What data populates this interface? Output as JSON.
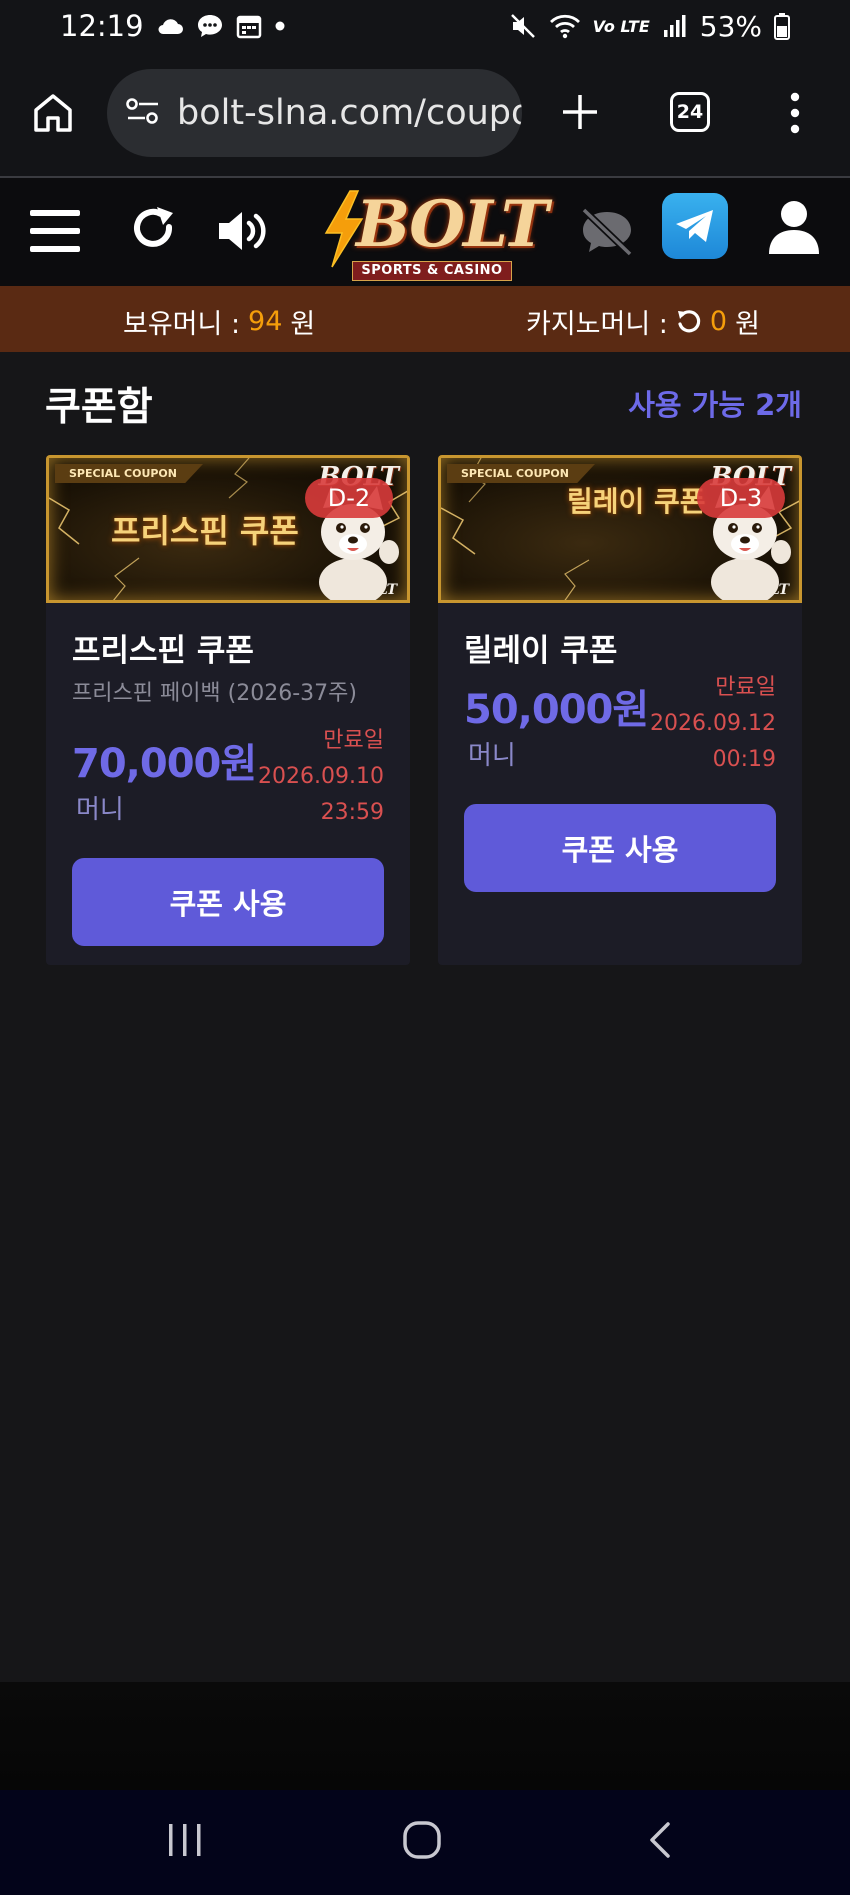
{
  "status_bar": {
    "time": "12:19",
    "battery": "53%",
    "left_icons": [
      "cloud-icon",
      "chat-icon",
      "calendar-icon",
      "dot-icon"
    ],
    "right_icons": [
      "mute-icon",
      "wifi-icon",
      "volte-icon",
      "signal-icon",
      "battery-icon"
    ],
    "lte_label": "Vo LTE"
  },
  "browser": {
    "url": "bolt-slna.com/coupo",
    "tab_count": "24"
  },
  "header": {
    "logo_text": "BOLT",
    "logo_subtitle": "SPORTS & CASINO"
  },
  "balance": {
    "holding_label": "보유머니 :",
    "holding_value": "94",
    "holding_unit": "원",
    "casino_label": "카지노머니 :",
    "casino_value": "0",
    "casino_unit": "원"
  },
  "coupon_box": {
    "title": "쿠폰함",
    "available": "사용 가능 2개"
  },
  "coupons": [
    {
      "banner_tag": "SPECIAL COUPON",
      "banner_title": "프리스핀 쿠폰",
      "banner_logo": "BOLT",
      "dday": "D-2",
      "name": "프리스핀 쿠폰",
      "subtitle": "프리스핀 페이백 (2026-37주)",
      "amount": "70,000원",
      "type": "머니",
      "expire_label": "만료일",
      "expire_date": "2026.09.10",
      "expire_time": "23:59",
      "button": "쿠폰 사용"
    },
    {
      "banner_tag": "SPECIAL COUPON",
      "banner_title": "릴레이 쿠폰",
      "banner_logo": "BOLT",
      "dday": "D-3",
      "name": "릴레이 쿠폰",
      "subtitle": "",
      "amount": "50,000원",
      "type": "머니",
      "expire_label": "만료일",
      "expire_date": "2026.09.12",
      "expire_time": "00:19",
      "button": "쿠폰 사용"
    }
  ],
  "colors": {
    "accent": "#5f5ad9",
    "amount": "#6f6ae6",
    "expire": "#d95050",
    "balance_bar": "#5a2a13",
    "highlight": "#f59e0b"
  }
}
